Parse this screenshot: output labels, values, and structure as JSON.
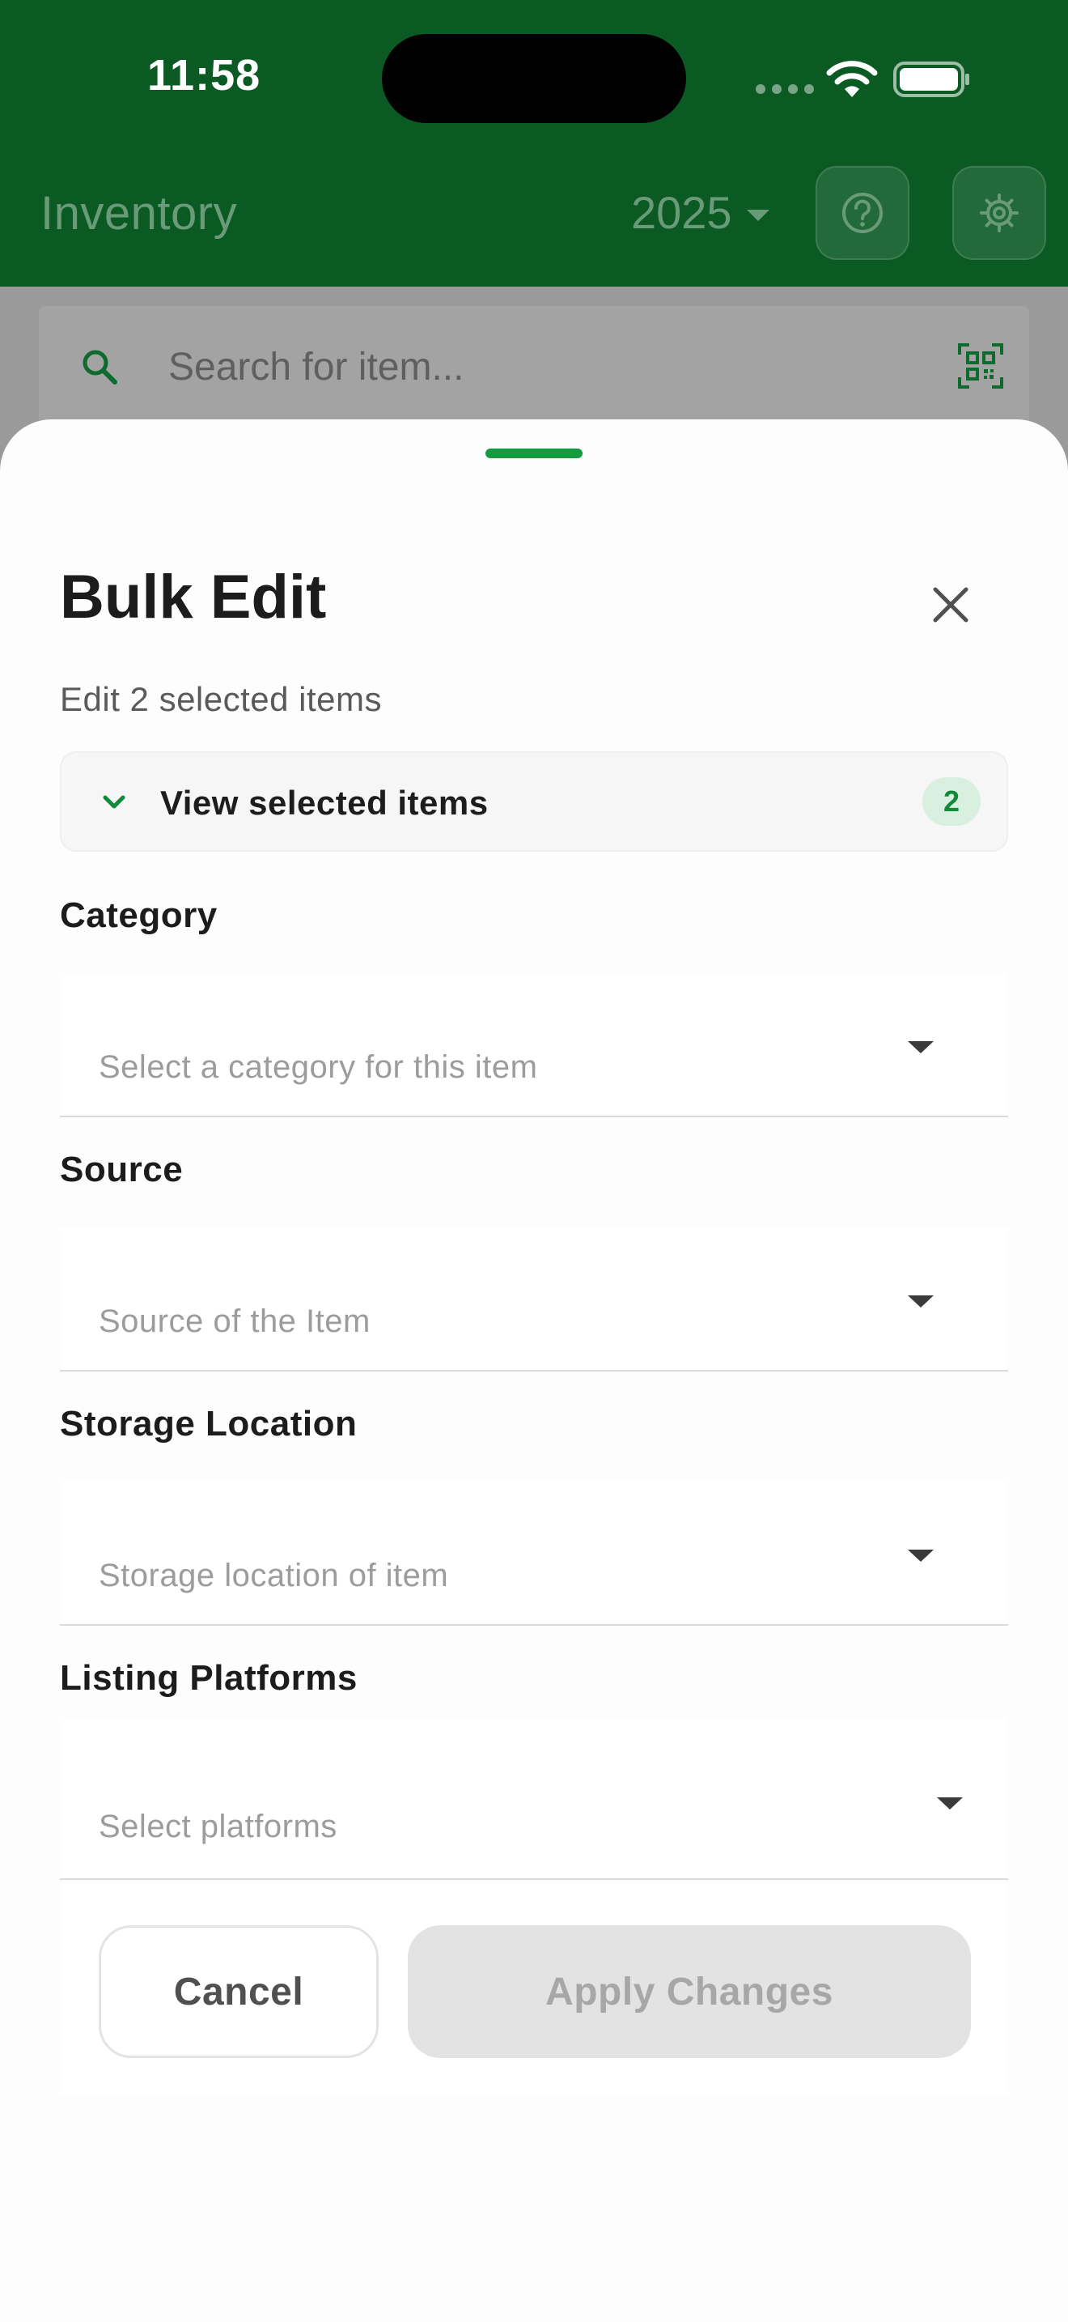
{
  "status_bar": {
    "time": "11:58"
  },
  "header": {
    "title": "Inventory",
    "year": "2025",
    "help_icon": "help-circle-icon",
    "settings_icon": "gear-icon"
  },
  "search": {
    "placeholder": "Search for item...",
    "icon": "search-icon",
    "scan_icon": "qr-scan-icon"
  },
  "sheet": {
    "title": "Bulk Edit",
    "subtitle": "Edit 2 selected items",
    "selected_panel": {
      "label": "View selected items",
      "count": "2"
    },
    "fields": {
      "category": {
        "label": "Category",
        "placeholder": "Select a category for this item"
      },
      "source": {
        "label": "Source",
        "placeholder": "Source of the Item"
      },
      "storage": {
        "label": "Storage Location",
        "placeholder": "Storage location of item"
      },
      "platforms": {
        "label": "Listing Platforms",
        "placeholder": "Select platforms"
      }
    },
    "actions": {
      "cancel": "Cancel",
      "apply": "Apply Changes"
    }
  },
  "colors": {
    "header_green": "#0b5a24",
    "accent_green": "#169a3f",
    "badge_bg": "#d9efdf",
    "badge_text": "#138a3a",
    "disabled_button": "#e3e3e3"
  }
}
